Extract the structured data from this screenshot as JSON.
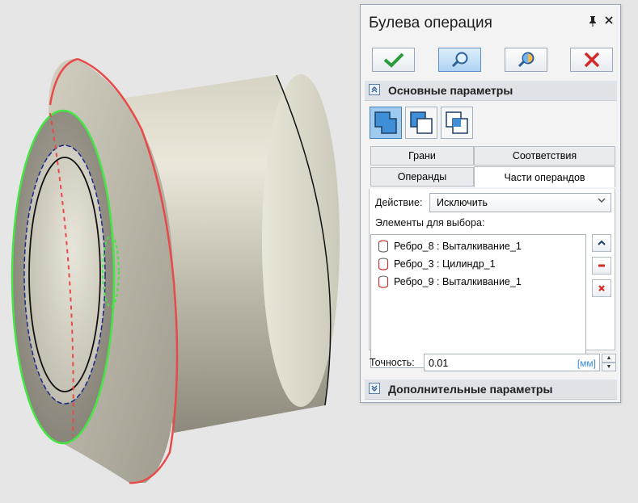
{
  "panel": {
    "title": "Булева операция",
    "pin_icon": "pin-icon",
    "close_icon": "close-icon",
    "commands": [
      {
        "name": "ok",
        "icon": "checkmark-icon",
        "color": "#2a9c3a"
      },
      {
        "name": "preview",
        "icon": "magnifier-icon",
        "active": true
      },
      {
        "name": "preview-result",
        "icon": "magnifier-color-icon"
      },
      {
        "name": "cancel",
        "icon": "cross-icon",
        "color": "#d42a2a"
      }
    ]
  },
  "main_section": {
    "title": "Основные параметры",
    "modes": [
      "union-icon",
      "subtract-icon",
      "intersect-icon"
    ]
  },
  "tabs": {
    "row1": [
      "Грани",
      "Соответствия"
    ],
    "row2": [
      "Операнды",
      "Части операндов"
    ],
    "active": "Части операндов"
  },
  "action": {
    "label": "Действие:",
    "value": "Исключить"
  },
  "elements": {
    "label": "Элементы для выбора:",
    "items": [
      "Ребро_8 : Выталкивание_1",
      "Ребро_3 : Цилиндр_1",
      "Ребро_9 : Выталкивание_1"
    ]
  },
  "precision": {
    "label": "Точность:",
    "value": "0.01",
    "unit": "[мм]"
  },
  "extra_section": {
    "title": "Дополнительные параметры"
  }
}
